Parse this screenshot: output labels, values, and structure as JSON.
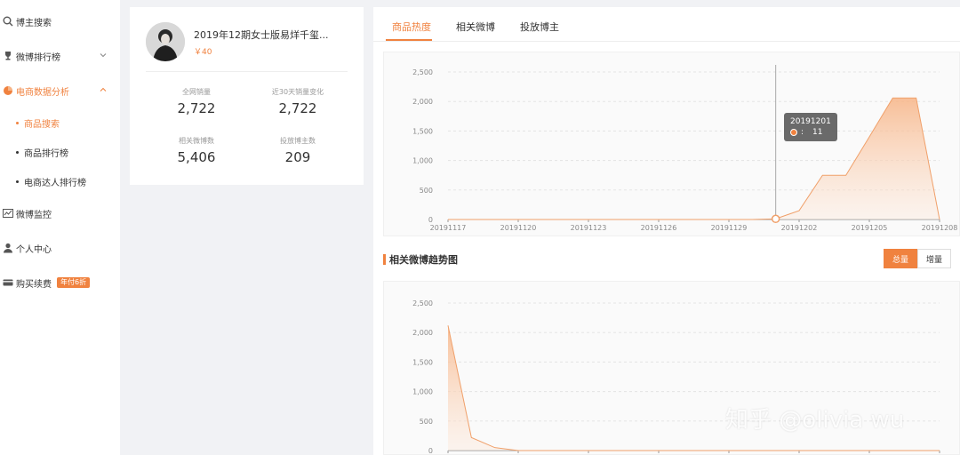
{
  "sidebar": {
    "items": [
      {
        "label": "博主搜索",
        "icon": "search-icon"
      },
      {
        "label": "微博排行榜",
        "icon": "trophy-icon"
      },
      {
        "label": "电商数据分析",
        "icon": "pie-chart-icon"
      },
      {
        "label": "微博监控",
        "icon": "line-chart-icon"
      },
      {
        "label": "个人中心",
        "icon": "user-icon"
      },
      {
        "label": "购买续费",
        "icon": "card-icon"
      }
    ],
    "sub_items": [
      "商品搜索",
      "商品排行榜",
      "电商达人排行榜"
    ],
    "badge": "年付6折",
    "accent": "#f0823f"
  },
  "product": {
    "title": "2019年12期女士版易烊千玺...",
    "price": "￥40",
    "stats": [
      {
        "label": "全网销量",
        "value": "2,722"
      },
      {
        "label": "近30天销量变化",
        "value": "2,722"
      },
      {
        "label": "相关微博数",
        "value": "5,406"
      },
      {
        "label": "投放博主数",
        "value": "209"
      }
    ]
  },
  "tabs": [
    "商品热度",
    "相关微博",
    "投放博主"
  ],
  "section_title": "相关微博趋势图",
  "toggles": [
    "总量",
    "增量"
  ],
  "tooltip": {
    "title": "20191201",
    "sep": ":",
    "value": "11"
  },
  "watermark": "知乎 @olivia wu",
  "chart_data": [
    {
      "type": "area",
      "title": "",
      "ylim": [
        0,
        2500
      ],
      "yticks": [
        "0",
        "500",
        "1,000",
        "1,500",
        "2,000",
        "2,500"
      ],
      "xticks": [
        "20191117",
        "20191120",
        "20191123",
        "20191126",
        "20191129",
        "20191202",
        "20191205",
        "20191208"
      ],
      "x": [
        0,
        1,
        2,
        3,
        4,
        5,
        6,
        7,
        8,
        9,
        10,
        11,
        12,
        13,
        14,
        15,
        16,
        17,
        18,
        19,
        20,
        21
      ],
      "values": [
        0,
        0,
        0,
        0,
        0,
        0,
        0,
        0,
        0,
        0,
        0,
        0,
        0,
        0,
        11,
        150,
        750,
        750,
        1400,
        2060,
        2060,
        0
      ],
      "grid": true
    },
    {
      "type": "area",
      "title": "",
      "ylim": [
        0,
        2500
      ],
      "yticks": [
        "0",
        "500",
        "1,000",
        "1,500",
        "2,000",
        "2,500"
      ],
      "x": [
        0,
        1,
        2,
        3,
        4,
        5,
        6,
        7,
        8,
        9,
        10,
        11,
        12,
        13,
        14,
        15,
        16,
        17,
        18,
        19,
        20,
        21
      ],
      "values": [
        2120,
        220,
        50,
        0,
        0,
        0,
        0,
        0,
        0,
        0,
        0,
        0,
        0,
        0,
        0,
        0,
        0,
        0,
        0,
        0,
        0,
        0
      ],
      "grid": true
    }
  ]
}
